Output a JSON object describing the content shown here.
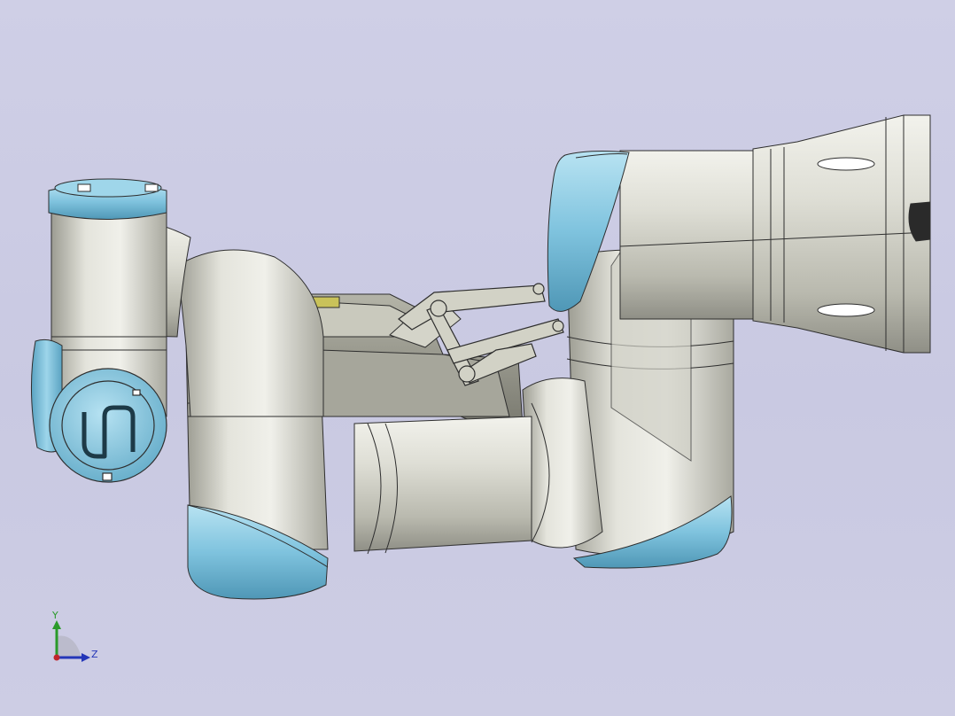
{
  "viewport": {
    "background_top": "#cfcfe6",
    "background_bottom": "#cdcde4"
  },
  "model": {
    "body_color": "#d8d8cf",
    "cap_color": "#7fc3de",
    "edge_color": "#2e2e2e",
    "logo_mark": "UR"
  },
  "triad": {
    "y_label": "Y",
    "z_label": "Z",
    "y_color": "#2a9a2a",
    "z_color": "#2436b8",
    "x_color": "#c0262b"
  }
}
